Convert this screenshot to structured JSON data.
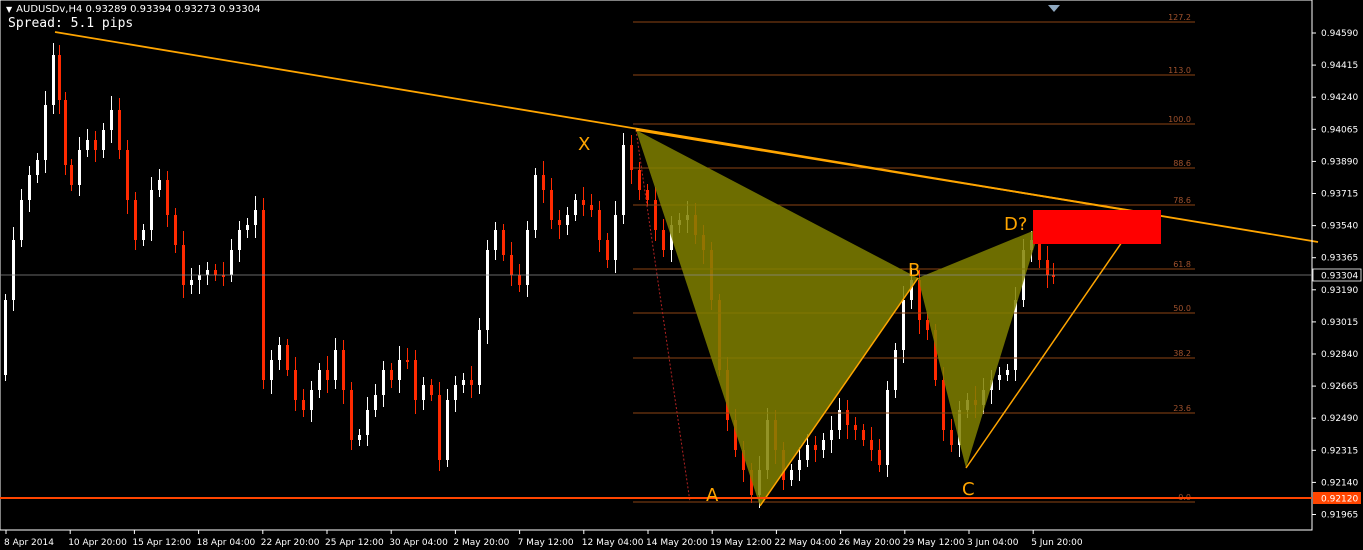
{
  "window": {
    "symbol_title": "AUDUSDv,H4  0.93289 0.93394 0.93273 0.93304",
    "spread": "Spread: 5.1 pips",
    "menu_icon": "dropdown-triangle-icon",
    "scroll_icon": "chart-shift-triangle-icon"
  },
  "price_axis": {
    "ticks": [
      "0.94590",
      "0.94415",
      "0.94240",
      "0.94065",
      "0.93890",
      "0.93715",
      "0.93540",
      "0.93365",
      "0.93190",
      "0.93015",
      "0.92840",
      "0.92665",
      "0.92490",
      "0.92315",
      "0.92140",
      "0.91965"
    ],
    "current_price_label": "0.93304",
    "support_price_label": "0.92120"
  },
  "time_axis": {
    "ticks": [
      "8 Apr 2014",
      "10 Apr 20:00",
      "15 Apr 12:00",
      "18 Apr 04:00",
      "22 Apr 20:00",
      "25 Apr 12:00",
      "30 Apr 04:00",
      "2 May 20:00",
      "7 May 12:00",
      "12 May 04:00",
      "14 May 20:00",
      "19 May 12:00",
      "22 May 04:00",
      "26 May 20:00",
      "29 May 12:00",
      "3 Jun 04:00",
      "5 Jun 20:00"
    ]
  },
  "fibonacci": {
    "levels": [
      "127.2",
      "113.0",
      "100.0",
      "88.6",
      "78.6",
      "61.8",
      "50.0",
      "38.2",
      "23.6",
      "0.0"
    ]
  },
  "pattern_labels": {
    "x": "X",
    "a": "A",
    "b": "B",
    "c": "C",
    "d": "D?"
  },
  "colors": {
    "background": "#000000",
    "bull_candle": "#ffffff",
    "bear_candle": "#ff2a00",
    "trendline": "#ffa500",
    "support_line": "#ff4500",
    "fib_line": "#8b4513",
    "pattern_fill": "#808000",
    "target_zone": "#ff0000",
    "axis_text": "#ffffff"
  }
}
